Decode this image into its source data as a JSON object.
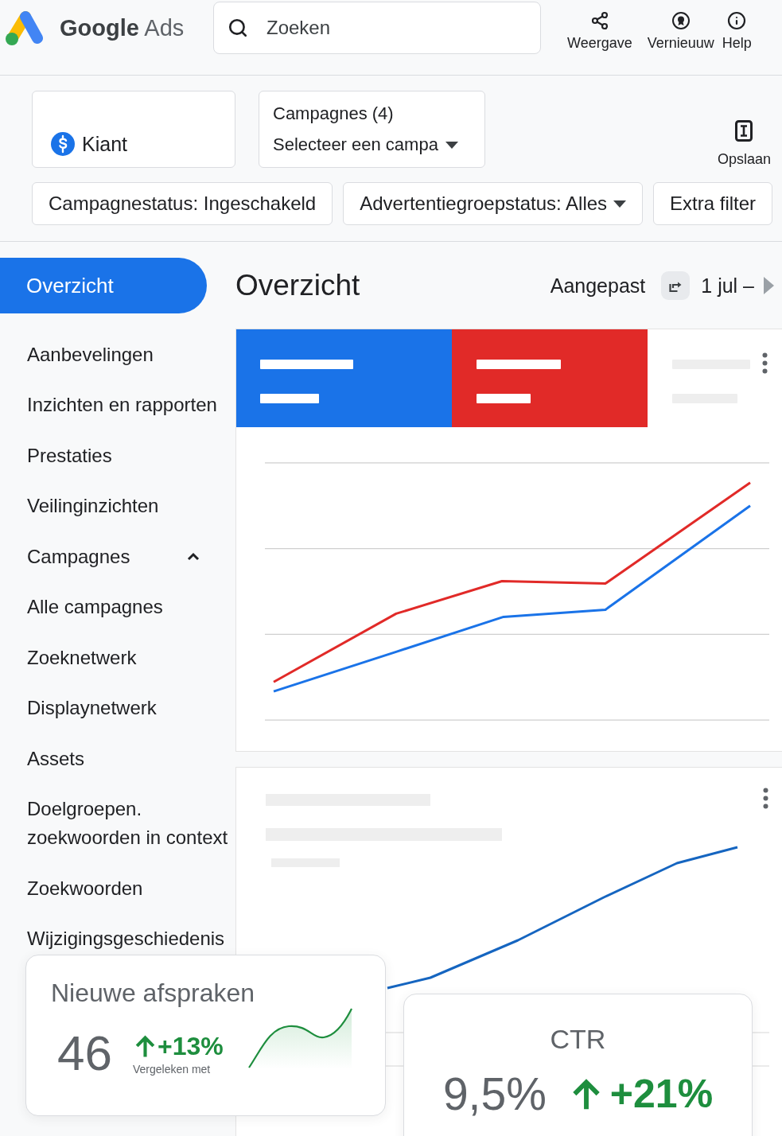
{
  "header": {
    "logo_text": "**Google** Ads",
    "search": {
      "placeholder": "Zoeken"
    },
    "actions": [
      {
        "kind": "share",
        "label": "Weergave"
      },
      {
        "kind": "badge",
        "label": "Vernieuuw"
      },
      {
        "kind": "info",
        "label": "Help"
      }
    ]
  },
  "filters": {
    "account": {
      "label": "Kiant"
    },
    "campaigns": {
      "title": "Campagnes (4)",
      "value": "Selecteer een campa"
    },
    "save": {
      "label": "Opslaan"
    },
    "chips": [
      {
        "label": "Campagnestatus: Ingeschakeld",
        "dropdown": false
      },
      {
        "label": "Advertentiegroepstatus: Alles",
        "dropdown": true
      },
      {
        "label": "Extra filter",
        "dropdown": false
      }
    ]
  },
  "sidebar": {
    "items": [
      {
        "label": "Overzicht",
        "selected": true
      },
      {
        "label": "Aanbevelingen",
        "selected": false
      },
      {
        "label": "Inzichten en rapporten",
        "selected": false
      },
      {
        "label": "Prestaties",
        "selected": false
      },
      {
        "label": "Veilinginzichten",
        "selected": false
      },
      {
        "label": "Campagnes",
        "selected": false,
        "expanded": true
      },
      {
        "label": "Alle campagnes",
        "selected": false
      },
      {
        "label": "Zoeknetwerk",
        "selected": false
      },
      {
        "label": "Displaynetwerk",
        "selected": false
      },
      {
        "label": "Assets",
        "selected": false
      },
      {
        "label": "Doelgroepen. zoekwoorden in context",
        "selected": false
      },
      {
        "label": "Zoekwoorden",
        "selected": false
      },
      {
        "label": "Wijzigingsgeschiedenis",
        "selected": false
      }
    ]
  },
  "overview": {
    "title": "Overzicht",
    "date_range": {
      "label": "Aangepast",
      "value": "1 jul –"
    }
  },
  "performance_card": {
    "tiles": [
      {
        "selected": true,
        "color": "#1a73e8"
      },
      {
        "selected": true,
        "color": "#e12a28"
      },
      {
        "selected": false
      }
    ]
  },
  "scorecards": [
    {
      "kind": "sparkline",
      "title": "Nieuwe afspraken",
      "value": "46",
      "rising": true,
      "change": "+13%",
      "note": "Vergeleken met"
    },
    {
      "kind": "centered",
      "title": "CTR",
      "value": "9,5%",
      "rising": true,
      "change": "+21%"
    }
  ]
}
